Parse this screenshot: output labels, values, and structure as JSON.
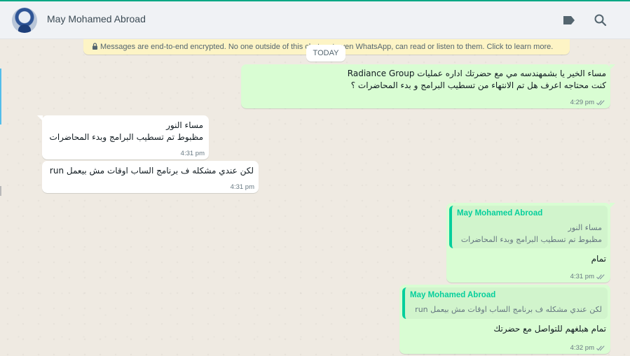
{
  "header": {
    "contact_name": "May Mohamed Abroad"
  },
  "chat": {
    "encryption_notice": "Messages are end-to-end encrypted. No one outside of this chat, not even WhatsApp, can read or listen to them. Click to learn more.",
    "date_divider": "TODAY",
    "messages": [
      {
        "direction": "outgoing",
        "lines": [
          "مساء الخير يا بشمهندسه مي  مع حضرتك اداره عمليات Radiance Group",
          "كنت محتاجه اعرف هل تم الانتهاء من تسطيب البرامج و بدء المحاضرات  ؟"
        ],
        "time": "4:29 pm",
        "status": "read"
      },
      {
        "direction": "incoming",
        "lines": [
          "مساء النور",
          "مظبوط تم تسطيب البرامج وبدء المحاضرات"
        ],
        "time": "4:31 pm"
      },
      {
        "direction": "incoming",
        "lines": [
          "لكن عندي مشكله ف برنامج الساب اوقات مش بيعمل run"
        ],
        "time": "4:31 pm"
      },
      {
        "direction": "outgoing",
        "quoted": {
          "author": "May Mohamed Abroad",
          "lines": [
            "مساء النور",
            "مظبوط تم تسطيب البرامج وبدء المحاضرات"
          ]
        },
        "lines": [
          "تمام"
        ],
        "time": "4:31 pm",
        "status": "read"
      },
      {
        "direction": "outgoing",
        "quoted": {
          "author": "May Mohamed Abroad",
          "lines": [
            "لكن عندي مشكله ف برنامج الساب اوقات مش بيعمل run"
          ]
        },
        "lines": [
          "تمام هبلغهم للتواصل مع حضرتك"
        ],
        "time": "4:32 pm",
        "status": "read"
      }
    ]
  },
  "colors": {
    "accent": "#00a884",
    "outgoing_bubble": "#d9fdd3",
    "incoming_bubble": "#ffffff",
    "quote_author": "#06cf9c",
    "encryption_banner": "#fdf4c5"
  },
  "icons": [
    "contact-avatar",
    "label-icon",
    "search-icon",
    "lock-icon",
    "double-check-icon"
  ]
}
